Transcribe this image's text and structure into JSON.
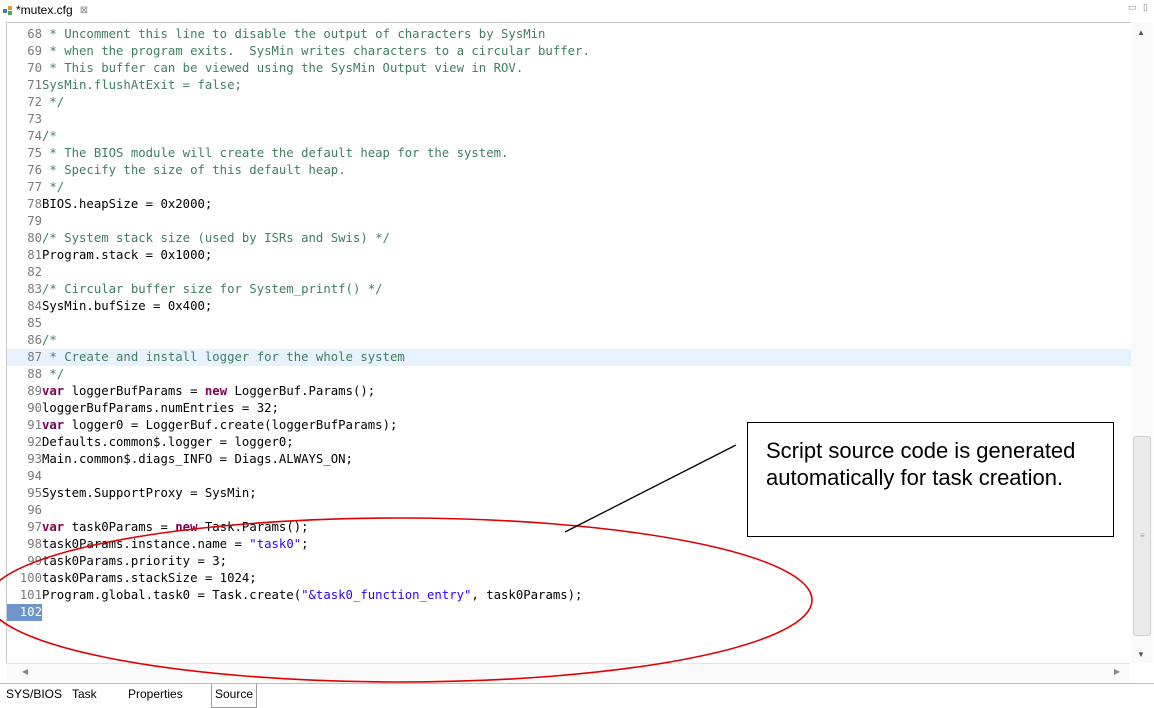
{
  "tab": {
    "title": "*mutex.cfg",
    "close_glyph": "⊠",
    "icon": "config-file-icon"
  },
  "window_controls": "▭ ▯",
  "editor": {
    "lines": [
      {
        "num": "68",
        "parts": [
          {
            "cls": "comment",
            "text": " * Uncomment this line to disable the output of characters by SysMin"
          }
        ]
      },
      {
        "num": "69",
        "parts": [
          {
            "cls": "comment",
            "text": " * when the program exits.  SysMin writes characters to a circular buffer."
          }
        ]
      },
      {
        "num": "70",
        "parts": [
          {
            "cls": "comment",
            "text": " * This buffer can be viewed using the SysMin Output view in ROV."
          }
        ]
      },
      {
        "num": "71",
        "parts": [
          {
            "cls": "comment",
            "text": "SysMin.flushAtExit = false;"
          }
        ]
      },
      {
        "num": "72",
        "parts": [
          {
            "cls": "comment",
            "text": " */"
          }
        ]
      },
      {
        "num": "73",
        "parts": []
      },
      {
        "num": "74",
        "parts": [
          {
            "cls": "comment",
            "text": "/*"
          }
        ]
      },
      {
        "num": "75",
        "parts": [
          {
            "cls": "comment",
            "text": " * The BIOS module will create the default heap for the system."
          }
        ]
      },
      {
        "num": "76",
        "parts": [
          {
            "cls": "comment",
            "text": " * Specify the size of this default heap."
          }
        ]
      },
      {
        "num": "77",
        "parts": [
          {
            "cls": "comment",
            "text": " */"
          }
        ]
      },
      {
        "num": "78",
        "parts": [
          {
            "cls": "code",
            "text": "BIOS.heapSize = 0x2000;"
          }
        ]
      },
      {
        "num": "79",
        "parts": []
      },
      {
        "num": "80",
        "parts": [
          {
            "cls": "comment",
            "text": "/* System stack size (used by ISRs and Swis) */"
          }
        ]
      },
      {
        "num": "81",
        "parts": [
          {
            "cls": "code",
            "text": "Program.stack = 0x1000;"
          }
        ]
      },
      {
        "num": "82",
        "parts": []
      },
      {
        "num": "83",
        "parts": [
          {
            "cls": "comment",
            "text": "/* Circular buffer size for System_printf() */"
          }
        ]
      },
      {
        "num": "84",
        "parts": [
          {
            "cls": "code",
            "text": "SysMin.bufSize = 0x400;"
          }
        ]
      },
      {
        "num": "85",
        "parts": []
      },
      {
        "num": "86",
        "parts": [
          {
            "cls": "comment",
            "text": "/*"
          }
        ]
      },
      {
        "num": "87",
        "highlight": true,
        "parts": [
          {
            "cls": "comment",
            "text": " * Create and install logger for the whole system"
          }
        ]
      },
      {
        "num": "88",
        "parts": [
          {
            "cls": "comment",
            "text": " */"
          }
        ]
      },
      {
        "num": "89",
        "parts": [
          {
            "cls": "kw",
            "text": "var"
          },
          {
            "cls": "code",
            "text": " loggerBufParams = "
          },
          {
            "cls": "kw",
            "text": "new"
          },
          {
            "cls": "code",
            "text": " LoggerBuf.Params();"
          }
        ]
      },
      {
        "num": "90",
        "parts": [
          {
            "cls": "code",
            "text": "loggerBufParams.numEntries = 32;"
          }
        ]
      },
      {
        "num": "91",
        "parts": [
          {
            "cls": "kw",
            "text": "var"
          },
          {
            "cls": "code",
            "text": " logger0 = LoggerBuf.create(loggerBufParams);"
          }
        ]
      },
      {
        "num": "92",
        "parts": [
          {
            "cls": "code",
            "text": "Defaults.common$.logger = logger0;"
          }
        ]
      },
      {
        "num": "93",
        "parts": [
          {
            "cls": "code",
            "text": "Main.common$.diags_INFO = Diags.ALWAYS_ON;"
          }
        ]
      },
      {
        "num": "94",
        "parts": []
      },
      {
        "num": "95",
        "parts": [
          {
            "cls": "code",
            "text": "System.SupportProxy = SysMin;"
          }
        ]
      },
      {
        "num": "96",
        "parts": []
      },
      {
        "num": "97",
        "parts": [
          {
            "cls": "kw",
            "text": "var"
          },
          {
            "cls": "code",
            "text": " task0Params = "
          },
          {
            "cls": "kw",
            "text": "new"
          },
          {
            "cls": "code",
            "text": " Task.Params();"
          }
        ]
      },
      {
        "num": "98",
        "parts": [
          {
            "cls": "code",
            "text": "task0Params.instance.name = "
          },
          {
            "cls": "str",
            "text": "\"task0\""
          },
          {
            "cls": "code",
            "text": ";"
          }
        ]
      },
      {
        "num": "99",
        "parts": [
          {
            "cls": "code",
            "text": "task0Params.priority = 3;"
          }
        ]
      },
      {
        "num": "100",
        "parts": [
          {
            "cls": "code",
            "text": "task0Params.stackSize = 1024;"
          }
        ]
      },
      {
        "num": "101",
        "parts": [
          {
            "cls": "code",
            "text": "Program.global.task0 = Task.create("
          },
          {
            "cls": "str",
            "text": "\"&task0_function_entry\""
          },
          {
            "cls": "code",
            "text": ", task0Params);"
          }
        ]
      },
      {
        "num": "102",
        "last": true,
        "parts": []
      }
    ]
  },
  "scrollbar": {
    "up": "▲",
    "down": "▼",
    "left": "◀",
    "right": "▶",
    "grip": "≡"
  },
  "bottom_tabs": [
    {
      "label": "SYS/BIOS",
      "active": false
    },
    {
      "label": "Task",
      "active": false
    },
    {
      "label": "Properties",
      "active": false
    },
    {
      "label": "Source",
      "active": true
    }
  ],
  "annotation": {
    "text": "Script source code is generated automatically for task creation."
  }
}
